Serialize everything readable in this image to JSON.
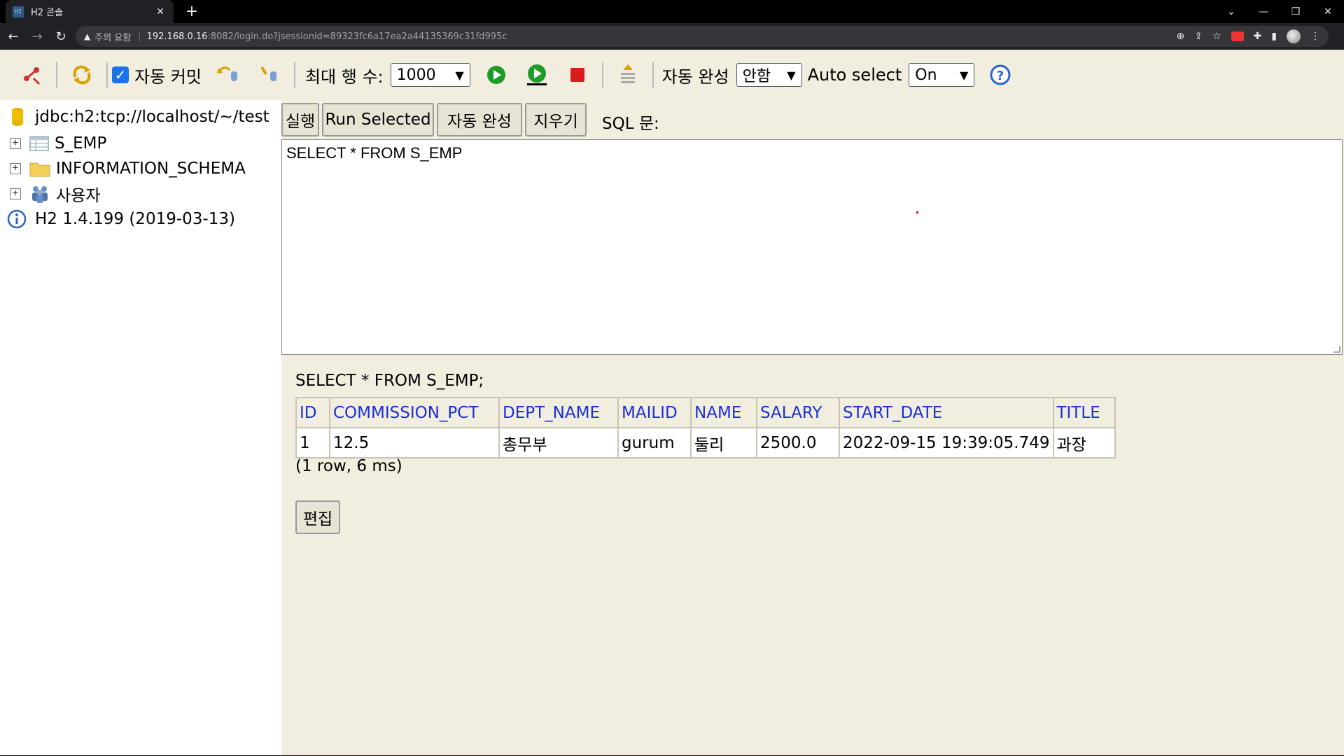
{
  "browser": {
    "tab_title": "H2 콘솔",
    "favicon_text": "H2",
    "warning_text": "주의 요함",
    "url_host": "192.168.0.16",
    "url_path": ":8082/login.do?jsessionid=89323fc6a17ea2a44135369c31fd995c"
  },
  "toolbar": {
    "auto_commit_label": "자동 커밋",
    "max_rows_label": "최대 행 수:",
    "max_rows_value": "1000",
    "auto_complete_label": "자동 완성",
    "auto_complete_value": "안함",
    "auto_select_label": "Auto select",
    "auto_select_value": "On"
  },
  "tree": {
    "connection": "jdbc:h2:tcp://localhost/~/test",
    "items": [
      {
        "label": "S_EMP"
      },
      {
        "label": "INFORMATION_SCHEMA"
      },
      {
        "label": "사용자"
      }
    ],
    "version": "H2 1.4.199 (2019-03-13)"
  },
  "buttons": {
    "run": "실행",
    "run_selected": "Run Selected",
    "auto_complete": "자동 완성",
    "clear": "지우기",
    "sql_label": "SQL 문:",
    "edit": "편집"
  },
  "editor": {
    "sql": "SELECT * FROM S_EMP"
  },
  "result": {
    "query": "SELECT * FROM S_EMP;",
    "columns": [
      "ID",
      "COMMISSION_PCT",
      "DEPT_NAME",
      "MAILID",
      "NAME",
      "SALARY",
      "START_DATE",
      "TITLE"
    ],
    "rows": [
      [
        "1",
        "12.5",
        "총무부",
        "gurum",
        "둘리",
        "2500.0",
        "2022-09-15 19:39:05.749",
        "과장"
      ]
    ],
    "row_count": "(1 row, 6 ms)"
  },
  "colors": {
    "page_bg": "#f1eee0",
    "header_link": "#1c2fd6",
    "checkbox": "#1a73e8"
  }
}
